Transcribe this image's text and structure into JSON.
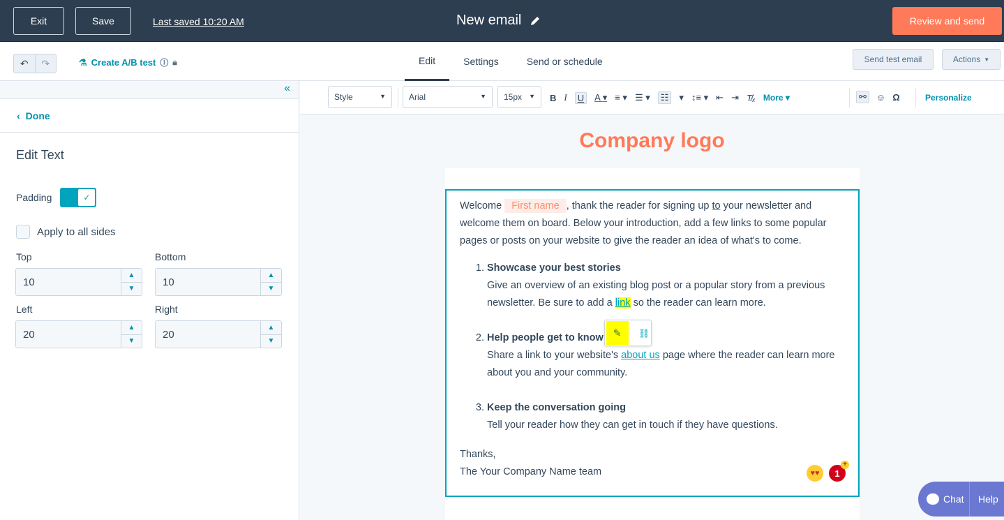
{
  "topbar": {
    "exit_label": "Exit",
    "save_label": "Save",
    "last_saved": "Last saved 10:20 AM",
    "title": "New email",
    "review_label": "Review and send"
  },
  "subbar": {
    "ab_test_label": "Create A/B test",
    "tabs": [
      {
        "label": "Edit",
        "active": true
      },
      {
        "label": "Settings",
        "active": false
      },
      {
        "label": "Send or schedule",
        "active": false
      }
    ],
    "send_test_label": "Send test email",
    "actions_label": "Actions"
  },
  "panel": {
    "done_label": "Done",
    "title": "Edit Text",
    "padding_label": "Padding",
    "padding_enabled": true,
    "apply_all_label": "Apply to all sides",
    "apply_all_checked": false,
    "top_label": "Top",
    "top_value": "10",
    "bottom_label": "Bottom",
    "bottom_value": "10",
    "left_label": "Left",
    "left_value": "20",
    "right_label": "Right",
    "right_value": "20"
  },
  "toolbar": {
    "style_select": "Style",
    "font_select": "Arial",
    "size_select": "15px",
    "more_label": "More",
    "personalize_label": "Personalize"
  },
  "email": {
    "logo_text": "Company logo",
    "intro_before": "Welcome",
    "first_name_token": "First name",
    "intro_after_1": ", thank the reader for signing up ",
    "intro_to": "to",
    "intro_after_2": " your newsletter and welcome them on board. Below your introduction, add a few links to some popular pages or posts on your website to give the reader an idea of what's to come.",
    "items": [
      {
        "title": "Showcase your best stories",
        "text_before": "Give an overview of an existing blog post or a popular story from a previous newsletter. Be sure to add a ",
        "link": "link",
        "text_after": " so the reader can learn more."
      },
      {
        "title": "Help people get to know",
        "text_before": "Share a link to your website's ",
        "link": "about us",
        "text_after": " page where the reader can learn more about you and your community."
      },
      {
        "title": "Keep the conversation going",
        "text": "Tell your reader how they can get in touch if they have questions."
      }
    ],
    "thanks": "Thanks,",
    "signature": "The Your Company Name team",
    "notification_count": "1"
  },
  "chat": {
    "chat_label": "Chat",
    "help_label": "Help"
  },
  "colors": {
    "topbar": "#2d3e50",
    "accent": "#ff7a59",
    "link": "#00a4bd",
    "highlight": "#ffff00",
    "chat": "#6a78d1"
  }
}
